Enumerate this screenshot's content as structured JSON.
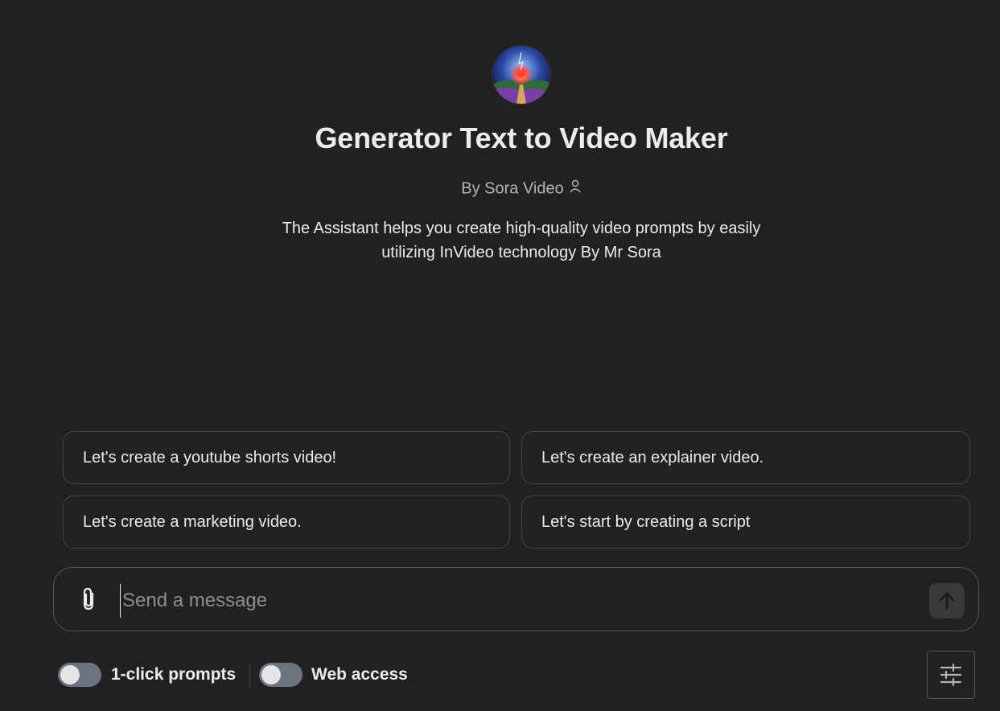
{
  "header": {
    "title": "Generator Text to Video Maker",
    "byline": "By Sora Video",
    "description": "The Assistant helps you create high-quality video prompts by easily utilizing InVideo technology By Mr Sora"
  },
  "suggestions": [
    "Let's create a youtube shorts video!",
    "Let's create an explainer video.",
    "Let's create a marketing video.",
    "Let's start by creating a script"
  ],
  "composer": {
    "placeholder": "Send a message",
    "attach_icon": "paperclip-icon",
    "send_icon": "arrow-up-icon"
  },
  "footer": {
    "toggle1_label": "1-click prompts",
    "toggle1_on": false,
    "toggle2_label": "Web access",
    "toggle2_on": false,
    "settings_icon": "sliders-icon"
  },
  "colors": {
    "background": "#212121",
    "text": "#ececec",
    "muted": "#b4b4b4",
    "border": "#444444",
    "toggle_off": "#6b7280"
  }
}
